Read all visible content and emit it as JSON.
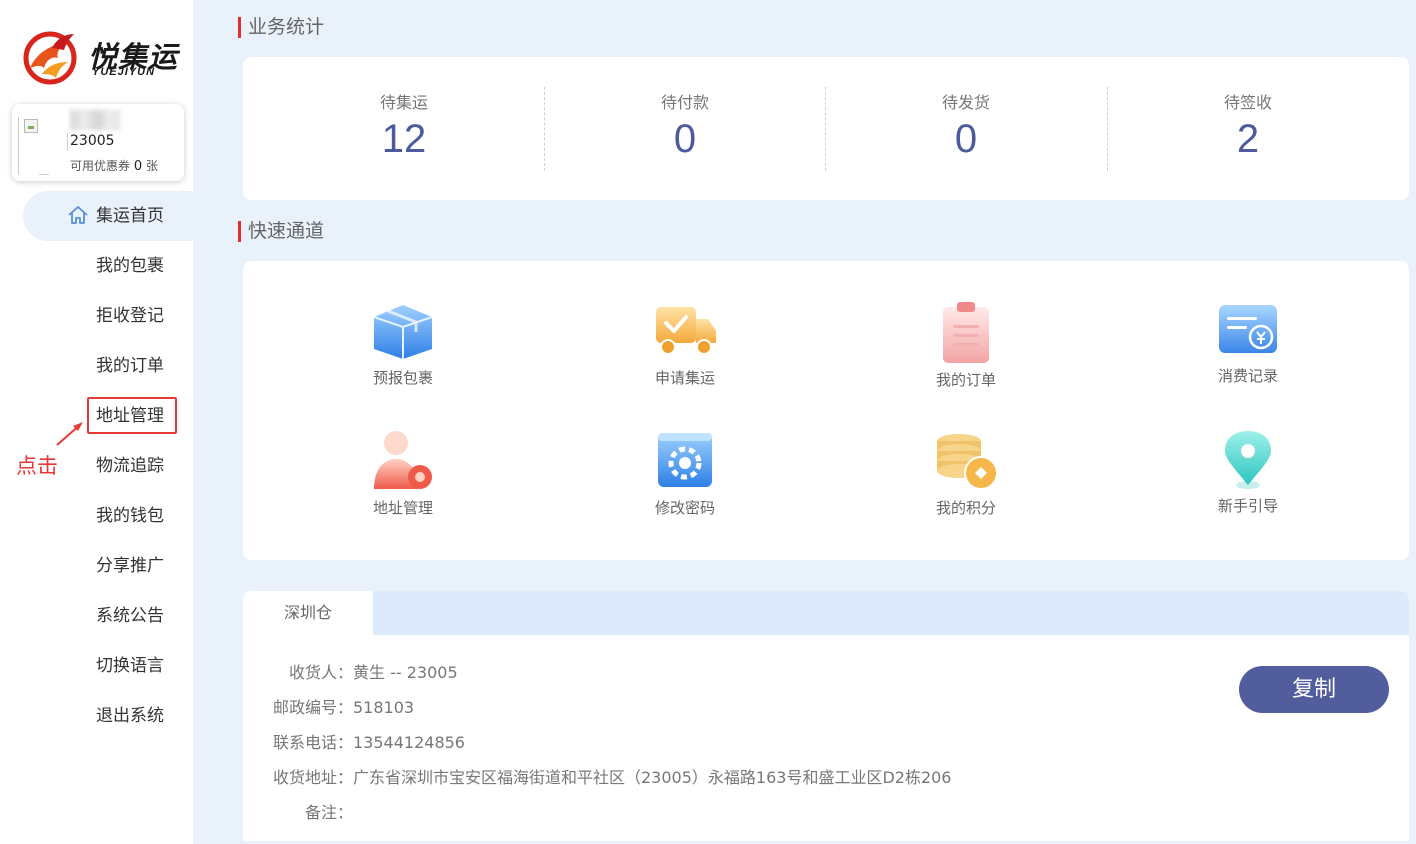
{
  "brand": {
    "name": "悦集运",
    "subtitle": "YUEJIYUN"
  },
  "user": {
    "id": "23005",
    "coupon_prefix": "可用优惠券",
    "coupon_count": "0",
    "coupon_unit": "张"
  },
  "sidebar": {
    "items": [
      {
        "label": "集运首页",
        "active": true,
        "icon": "home-icon"
      },
      {
        "label": "我的包裹"
      },
      {
        "label": "拒收登记"
      },
      {
        "label": "我的订单"
      },
      {
        "label": "地址管理",
        "highlighted": true
      },
      {
        "label": "物流追踪"
      },
      {
        "label": "我的钱包"
      },
      {
        "label": "分享推广"
      },
      {
        "label": "系统公告"
      },
      {
        "label": "切换语言"
      },
      {
        "label": "退出系统"
      }
    ]
  },
  "annotation": {
    "click_label": "点击",
    "color": "#e53935"
  },
  "stats": {
    "title": "业务统计",
    "items": [
      {
        "label": "待集运",
        "value": "12"
      },
      {
        "label": "待付款",
        "value": "0"
      },
      {
        "label": "待发货",
        "value": "0"
      },
      {
        "label": "待签收",
        "value": "2"
      }
    ]
  },
  "quick": {
    "title": "快速通道",
    "items": [
      {
        "label": "预报包裹",
        "icon": "package-icon"
      },
      {
        "label": "申请集运",
        "icon": "truck-icon"
      },
      {
        "label": "我的订单",
        "icon": "clipboard-icon"
      },
      {
        "label": "消费记录",
        "icon": "card-icon"
      },
      {
        "label": "地址管理",
        "icon": "user-gear-icon"
      },
      {
        "label": "修改密码",
        "icon": "gear-icon"
      },
      {
        "label": "我的积分",
        "icon": "coins-icon"
      },
      {
        "label": "新手引导",
        "icon": "location-pin-icon"
      }
    ]
  },
  "warehouse": {
    "tab": "深圳仓",
    "rows": [
      {
        "key": "收货人：",
        "value": "黄生 -- 23005"
      },
      {
        "key": "邮政编号：",
        "value": "518103"
      },
      {
        "key": "联系电话：",
        "value": "13544124856"
      },
      {
        "key": "收货地址：",
        "value": "广东省深圳市宝安区福海街道和平社区（23005）永福路163号和盛工业区D2栋206"
      },
      {
        "key": "备注：",
        "value": ""
      }
    ],
    "copy_label": "复制"
  },
  "colors": {
    "accent": "#525d9d",
    "stat_number": "#4d5a9b",
    "section_bar": "#e0302b",
    "background": "#e9f1fb"
  }
}
